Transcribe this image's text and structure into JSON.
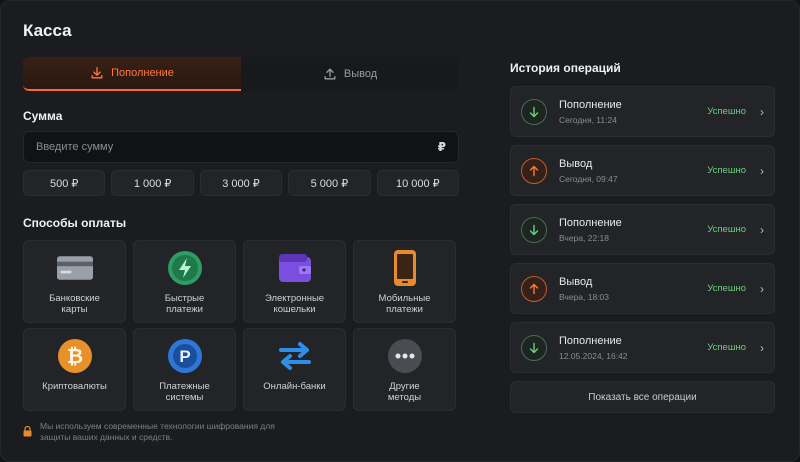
{
  "header": {
    "title": "Касса"
  },
  "tabs": [
    {
      "label": "Пополнение",
      "active": true,
      "icon": "download-icon"
    },
    {
      "label": "Вывод",
      "active": false,
      "icon": "upload-icon"
    }
  ],
  "amount": {
    "label": "Сумма",
    "placeholder": "Введите сумму",
    "currency": "₽"
  },
  "presets": [
    "500 ₽",
    "1 000 ₽",
    "3 000 ₽",
    "5 000 ₽",
    "10 000 ₽"
  ],
  "methods": {
    "label": "Способы оплаты",
    "items": [
      {
        "label": "Банковские\nкарты",
        "icon": "bank-card-icon"
      },
      {
        "label": "Быстрые\nплатежи",
        "icon": "lightning-icon"
      },
      {
        "label": "Электронные\nкошельки",
        "icon": "wallet-icon"
      },
      {
        "label": "Мобильные\nплатежи",
        "icon": "mobile-phone-icon"
      },
      {
        "label": "Криптовалюты",
        "icon": "bitcoin-icon"
      },
      {
        "label": "Платежные\nсистемы",
        "icon": "payment-system-icon"
      },
      {
        "label": "Онлайн-банки",
        "icon": "transfer-arrows-icon"
      },
      {
        "label": "Другие\nметоды",
        "icon": "more-icon"
      }
    ]
  },
  "security": {
    "text": "Мы используем современные технологии шифрования для защиты ваших данных и средств.",
    "icon": "lock-icon"
  },
  "history": {
    "title": "История операций",
    "items": [
      {
        "name": "Пополнение",
        "date": "Сегодня, 11:24",
        "status": "Успешно",
        "type": "in"
      },
      {
        "name": "Вывод",
        "date": "Сегодня, 09:47",
        "status": "Успешно",
        "type": "out"
      },
      {
        "name": "Пополнение",
        "date": "Вчера, 22:18",
        "status": "Успешно",
        "type": "in"
      },
      {
        "name": "Вывод",
        "date": "Вчера, 18:03",
        "status": "Успешно",
        "type": "out"
      },
      {
        "name": "Пополнение",
        "date": "12.05.2024, 16:42",
        "status": "Успешно",
        "type": "in"
      }
    ],
    "show_all": "Показать все операции"
  },
  "colors": {
    "accent": "#ff6a2b",
    "success": "#6ccf7e",
    "background": "#1b1c20",
    "card": "#232428"
  }
}
